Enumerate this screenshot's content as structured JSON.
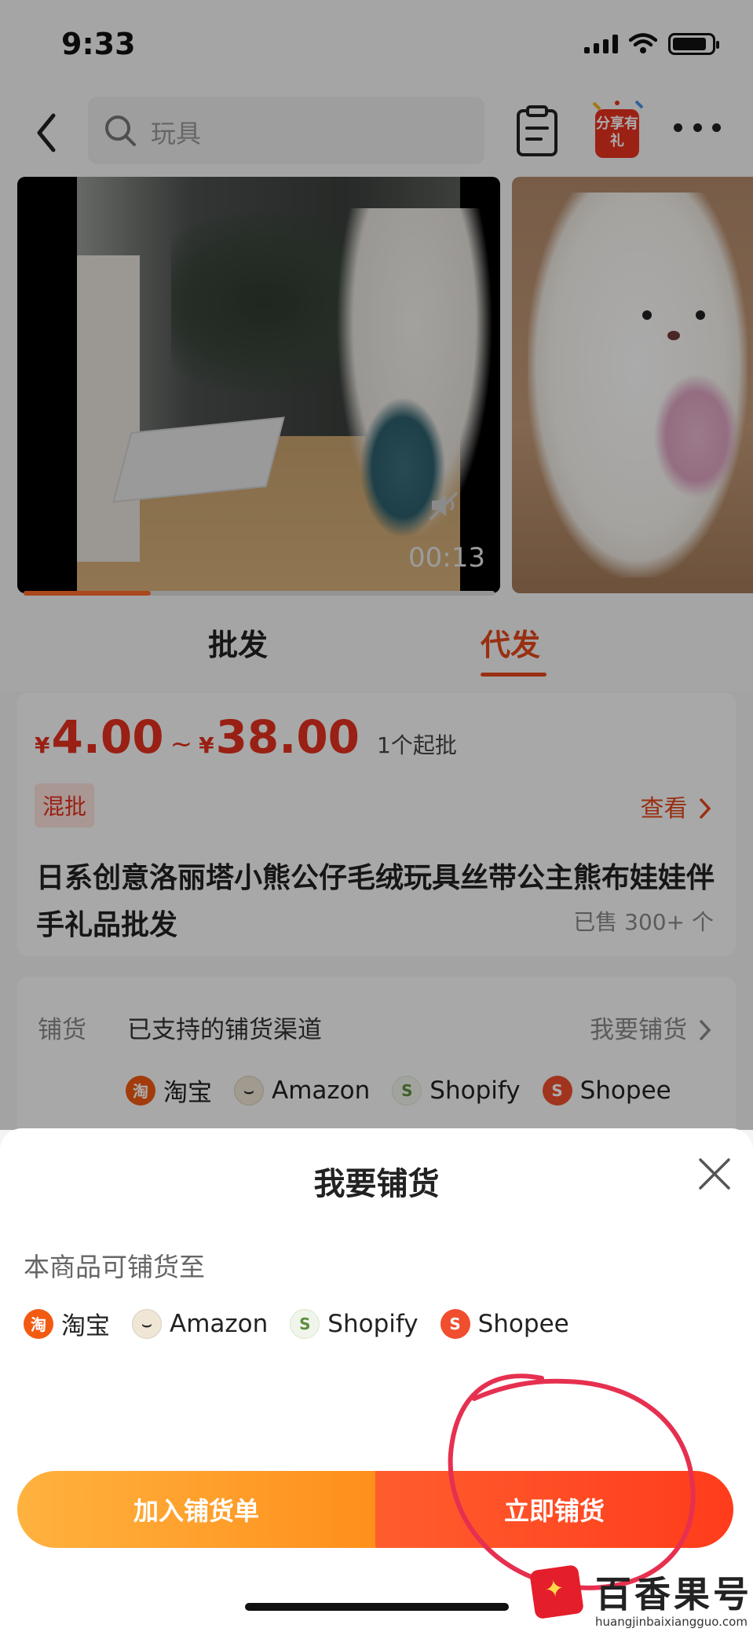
{
  "status_bar": {
    "time": "9:33"
  },
  "nav": {
    "search_placeholder": "玩具",
    "share_badge": "分享有礼"
  },
  "video": {
    "time": "00:13",
    "progress": 0.27
  },
  "tabs": {
    "wholesale": "批发",
    "dropship": "代发",
    "active": "dropship"
  },
  "price": {
    "currency": "¥",
    "min": "4.00",
    "tilde": "~",
    "max": "38.00",
    "moq": "1个起批",
    "mix_badge": "混批",
    "view_link": "查看",
    "title": "日系创意洛丽塔小熊公仔毛绒玩具丝带公主熊布娃娃伴手礼品批发",
    "sold": "已售 300+ 个"
  },
  "channels": {
    "label": "铺货",
    "description": "已支持的铺货渠道",
    "action": "我要铺货",
    "platforms": [
      "淘宝",
      "Amazon",
      "Shopify",
      "Shopee"
    ]
  },
  "sheet": {
    "title": "我要铺货",
    "subtitle": "本商品可铺货至",
    "platforms": [
      "淘宝",
      "Amazon",
      "Shopify",
      "Shopee"
    ],
    "add_button": "加入铺货单",
    "list_now_button": "立即铺货"
  },
  "icons": {
    "taobao": "淘",
    "amazon": "⌣",
    "shopify": "S",
    "shopee": "S"
  },
  "watermark": {
    "name": "百香果号",
    "url": "huangjinbaixiangguo.com"
  },
  "colors": {
    "accent": "#e4471a",
    "price": "#e4301f",
    "button_orange": "#ff9a24",
    "button_red": "#ff4a22"
  }
}
